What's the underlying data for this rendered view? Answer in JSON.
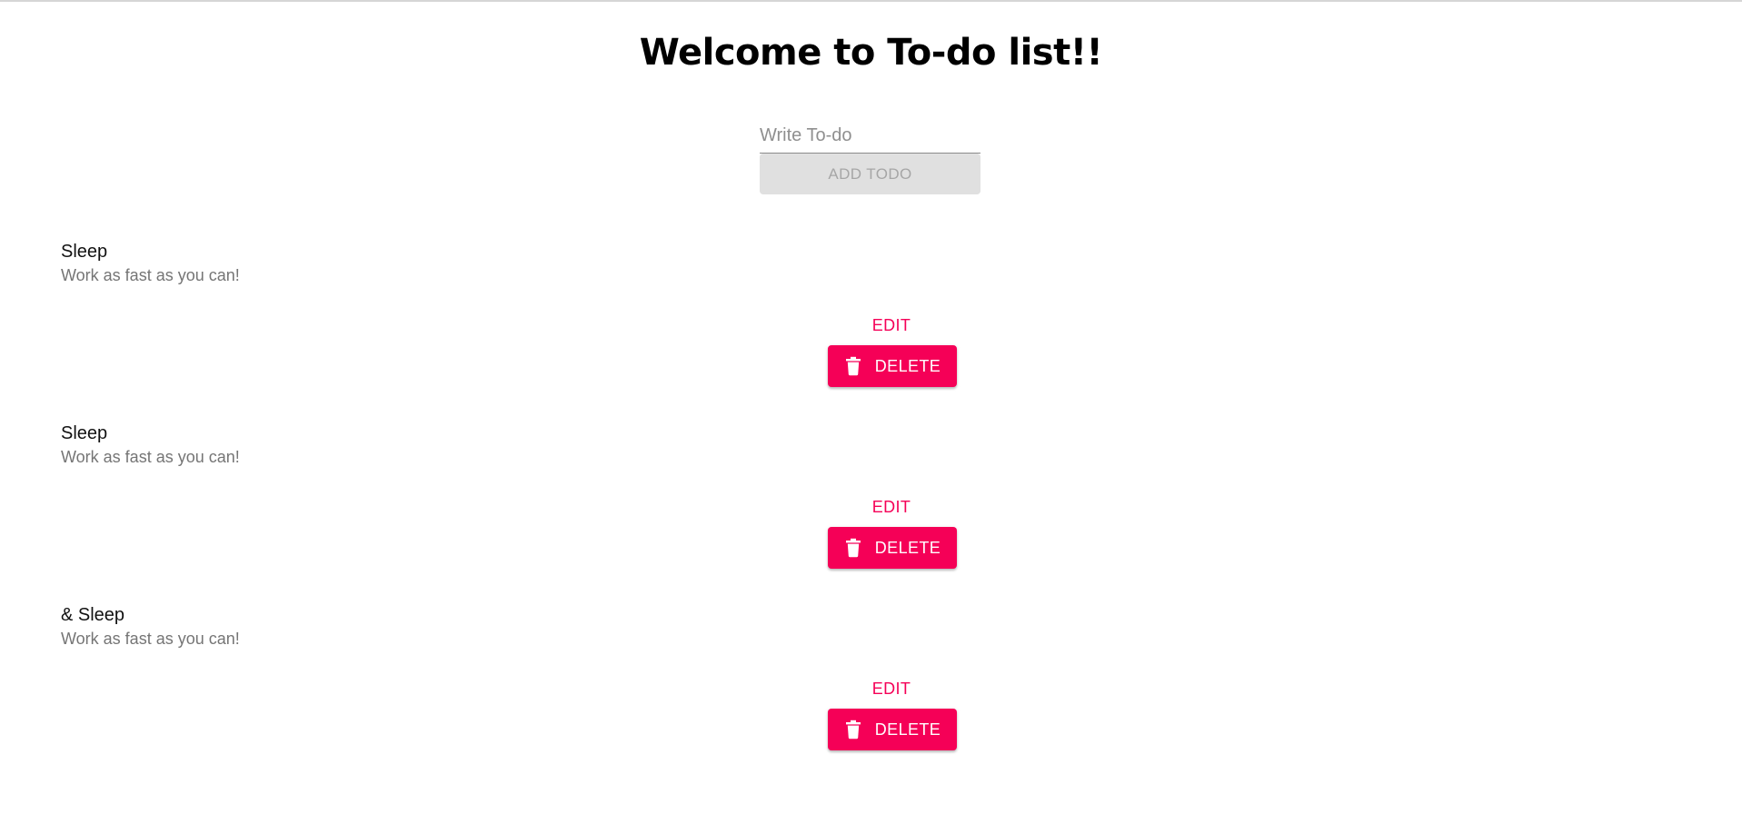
{
  "header": {
    "title": "Welcome to To-do list!!"
  },
  "form": {
    "input_placeholder": "Write To-do",
    "input_value": "",
    "add_label": "ADD TODO"
  },
  "todos": [
    {
      "title": "Sleep",
      "description": "Work as fast as you can!",
      "edit_label": "EDIT",
      "delete_label": "DELETE",
      "delete_icon": "trash-icon"
    },
    {
      "title": "Sleep",
      "description": "Work as fast as you can!",
      "edit_label": "EDIT",
      "delete_label": "DELETE",
      "delete_icon": "trash-icon"
    },
    {
      "title": "& Sleep",
      "description": "Work as fast as you can!",
      "edit_label": "EDIT",
      "delete_label": "DELETE",
      "delete_icon": "trash-icon"
    }
  ],
  "colors": {
    "accent": "#f50057",
    "disabled_bg": "#e0e0e0",
    "disabled_text": "#a6a6a6",
    "secondary_text": "#757575"
  }
}
